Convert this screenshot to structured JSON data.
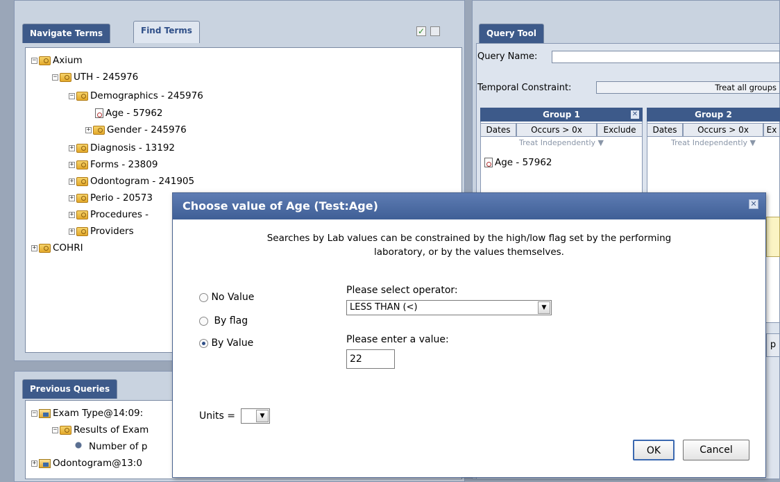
{
  "left_panel": {
    "tabs": [
      {
        "label": "Navigate Terms",
        "active": true
      },
      {
        "label": "Find Terms",
        "active": false
      }
    ],
    "tree": [
      {
        "label": "Axium",
        "depth": 0,
        "expander": "−",
        "icon": "folder-icon"
      },
      {
        "label": "UTH - 245976",
        "depth": 1,
        "expander": "−",
        "icon": "folder-icon"
      },
      {
        "label": "Demographics - 245976",
        "depth": 2,
        "expander": "−",
        "icon": "folder-icon"
      },
      {
        "label": "Age - 57962",
        "depth": 3,
        "expander": "",
        "icon": "leaf-term-icon"
      },
      {
        "label": "Gender - 245976",
        "depth": 3,
        "expander": "+",
        "icon": "folder-icon"
      },
      {
        "label": "Diagnosis - 13192",
        "depth": 2,
        "expander": "+",
        "icon": "folder-icon"
      },
      {
        "label": "Forms - 23809",
        "depth": 2,
        "expander": "+",
        "icon": "folder-icon"
      },
      {
        "label": "Odontogram - 241905",
        "depth": 2,
        "expander": "+",
        "icon": "folder-icon"
      },
      {
        "label": "Perio - 20573",
        "depth": 2,
        "expander": "+",
        "icon": "folder-icon"
      },
      {
        "label": "Procedures -",
        "depth": 2,
        "expander": "+",
        "icon": "folder-icon"
      },
      {
        "label": "Providers",
        "depth": 2,
        "expander": "+",
        "icon": "folder-icon"
      },
      {
        "label": "COHRI",
        "depth": 0,
        "expander": "+",
        "icon": "folder-icon"
      }
    ]
  },
  "previous_queries": {
    "tab_label": "Previous Queries",
    "items": [
      {
        "label": "Exam Type@14:09:",
        "depth": 0,
        "expander": "−",
        "icon": "query-icon"
      },
      {
        "label": "Results of Exam",
        "depth": 1,
        "expander": "−",
        "icon": "results-icon"
      },
      {
        "label": "Number of p",
        "depth": 2,
        "expander": "",
        "icon": "patient-count-icon"
      },
      {
        "label": "Odontogram@13:0",
        "depth": 0,
        "expander": "+",
        "icon": "query-icon"
      }
    ]
  },
  "query_tool": {
    "tab_label": "Query Tool",
    "query_name_label": "Query Name:",
    "temporal_label": "Temporal Constraint:",
    "temporal_value": "Treat all groups",
    "groups": [
      {
        "title": "Group 1",
        "dates": "Dates",
        "occurs": "Occurs > 0x",
        "exclude": "Exclude",
        "treat": "Treat Independently ▼",
        "items": [
          "Age - 57962"
        ]
      },
      {
        "title": "Group 2",
        "dates": "Dates",
        "occurs": "Occurs > 0x",
        "exclude": "Ex",
        "treat": "Treat Independently ▼",
        "items": []
      }
    ],
    "partial_button": "p"
  },
  "dialog": {
    "title": "Choose value of Age (Test:Age)",
    "close_glyph": "✕",
    "description_line1": "Searches by Lab values can be constrained by the high/low flag set by the performing",
    "description_line2": "laboratory, or by the values themselves.",
    "options": [
      {
        "label": "No Value",
        "selected": false
      },
      {
        "label": "By flag",
        "selected": false
      },
      {
        "label": "By Value",
        "selected": true
      }
    ],
    "operator_label": "Please select operator:",
    "operator_value": "LESS THAN (<)",
    "value_label": "Please enter a value:",
    "value": "22",
    "units_label": "Units =",
    "units_value": "",
    "ok_label": "OK",
    "cancel_label": "Cancel"
  },
  "colors": {
    "accent": "#3d5a8a",
    "background": "#9aa6b8"
  }
}
